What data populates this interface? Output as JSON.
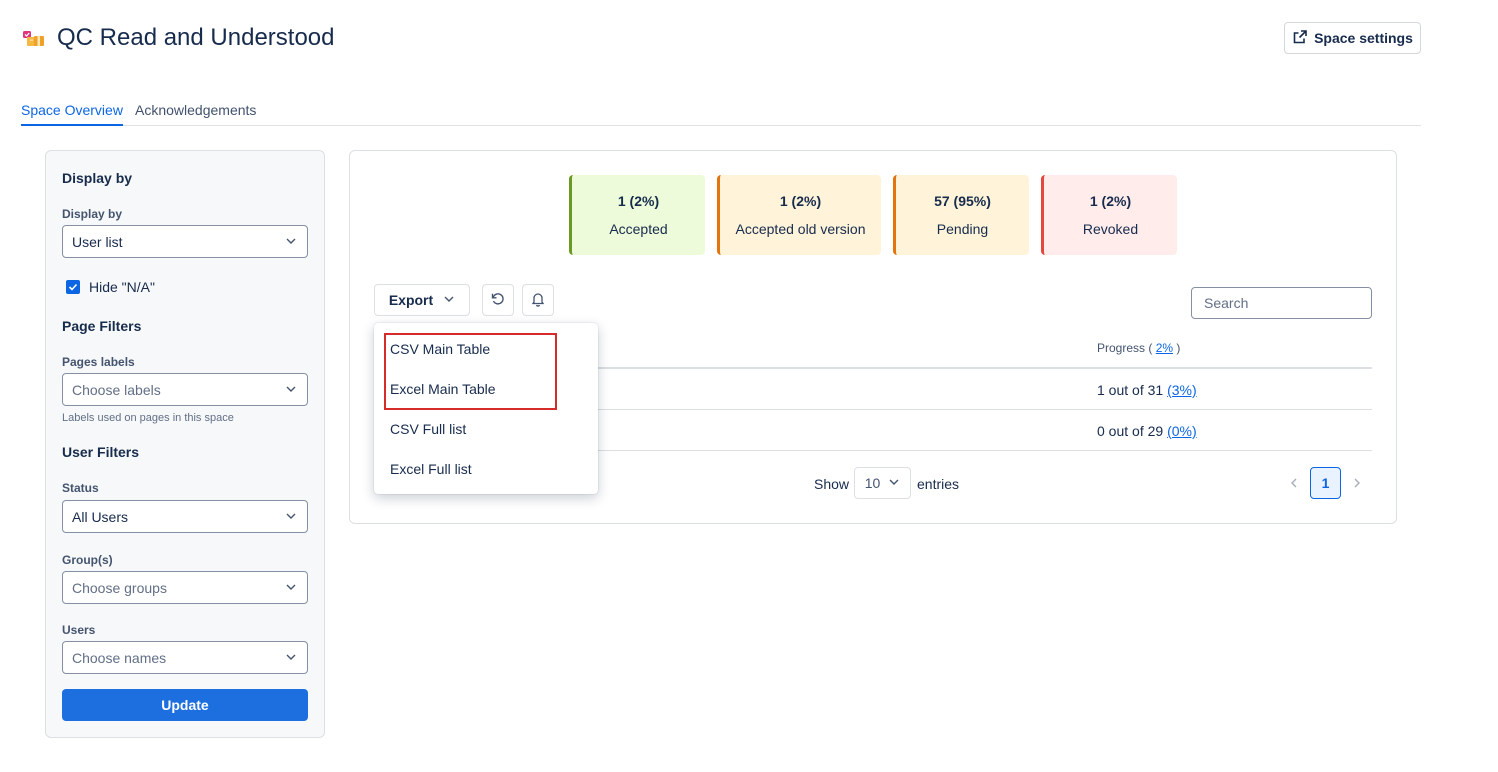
{
  "header": {
    "title": "QC Read and Understood",
    "space_icon": "space-emoji-icon",
    "settings_label": "Space settings",
    "settings_icon": "external-link-icon"
  },
  "tabs": [
    {
      "label": "Space Overview",
      "active": true
    },
    {
      "label": "Acknowledgements",
      "active": false
    }
  ],
  "sidebar": {
    "display_by_heading": "Display by",
    "display_by_label": "Display by",
    "display_by_value": "User list",
    "hide_na_label": "Hide \"N/A\"",
    "hide_na_checked": true,
    "page_filters_heading": "Page Filters",
    "pages_labels_label": "Pages labels",
    "pages_labels_placeholder": "Choose labels",
    "pages_labels_help": "Labels used on pages in this space",
    "user_filters_heading": "User Filters",
    "status_label": "Status",
    "status_value": "All Users",
    "groups_label": "Group(s)",
    "groups_placeholder": "Choose groups",
    "users_label": "Users",
    "users_placeholder": "Choose names",
    "update_label": "Update"
  },
  "stats": [
    {
      "value": "1 (2%)",
      "label": "Accepted",
      "bg": "#eefbda",
      "border": "#6a9a23"
    },
    {
      "value": "1 (2%)",
      "label": "Accepted old version",
      "bg": "#fff3d9",
      "border": "#e2740e"
    },
    {
      "value": "57 (95%)",
      "label": "Pending",
      "bg": "#fff3d9",
      "border": "#e2740e"
    },
    {
      "value": "1 (2%)",
      "label": "Revoked",
      "bg": "#ffeceb",
      "border": "#e2483d"
    }
  ],
  "toolbar": {
    "export_label": "Export",
    "refresh_icon": "refresh-icon",
    "bell_icon": "bell-icon",
    "search_placeholder": "Search"
  },
  "table": {
    "progress_header_prefix": "Progress (",
    "progress_header_value": "2%",
    "progress_header_suffix": ")",
    "rows": [
      {
        "progress_text": "1 out of 31",
        "progress_pct": "(3%)"
      },
      {
        "progress_text": "0 out of 29",
        "progress_pct": "(0%)"
      }
    ]
  },
  "pagination": {
    "show_label": "Show",
    "page_size": "10",
    "entries_label": "entries",
    "current_page": "1"
  },
  "export_menu": {
    "items": [
      "CSV Main Table",
      "Excel Main Table",
      "CSV Full list",
      "Excel Full list"
    ]
  },
  "colors": {
    "accent": "#0c66e4",
    "update_button": "#1d6fe0",
    "highlight_box": "#d52b2b"
  }
}
